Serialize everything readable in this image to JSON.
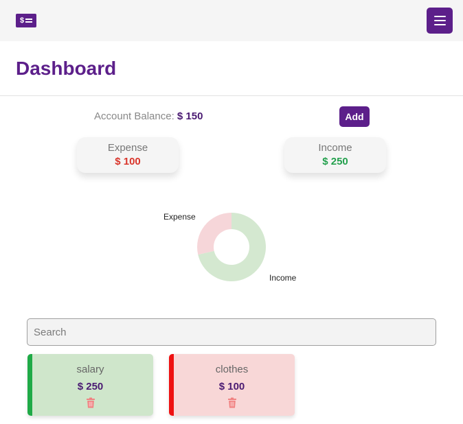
{
  "header": {
    "logo_text": "$",
    "logo_icon": "money-list-icon",
    "menu_icon": "hamburger-icon"
  },
  "page": {
    "title": "Dashboard"
  },
  "summary": {
    "balance_label": "Account Balance:",
    "balance_value": "$ 150",
    "add_label": "Add"
  },
  "stats": {
    "expense_label": "Expense",
    "expense_value": "$ 100",
    "income_label": "Income",
    "income_value": "$ 250"
  },
  "chart_data": {
    "type": "pie",
    "labels": [
      "Expense",
      "Income"
    ],
    "values": [
      100,
      250
    ],
    "colors": [
      "#f6d6d9",
      "#d4e8d0"
    ],
    "donut": true
  },
  "search": {
    "placeholder": "Search",
    "value": ""
  },
  "transactions": [
    {
      "name": "salary",
      "amount": "$ 250",
      "type": "income"
    },
    {
      "name": "clothes",
      "amount": "$ 100",
      "type": "expense"
    }
  ],
  "colors": {
    "primary": "#5c1f8a",
    "income": "#23a04d",
    "expense": "#d9352b"
  }
}
